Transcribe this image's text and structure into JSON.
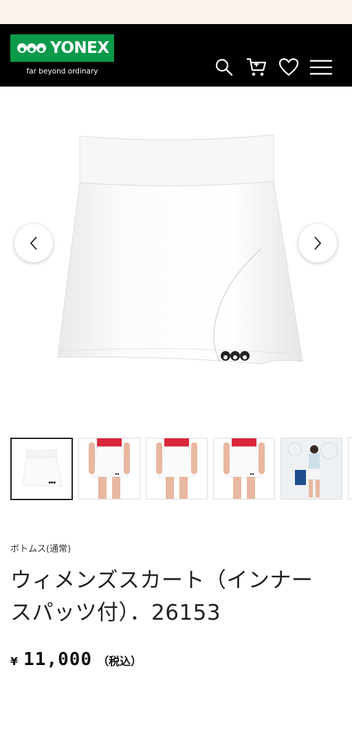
{
  "brand": {
    "name": "YONEX",
    "tagline": "far beyond ordinary",
    "color": "#0a9a4a"
  },
  "header": {
    "icons": [
      "search-icon",
      "cart-icon",
      "heart-icon",
      "menu-icon"
    ]
  },
  "gallery": {
    "prev_icon": "chevron-left-icon",
    "next_icon": "chevron-right-icon",
    "thumbnails": [
      "skirt-front",
      "model-front",
      "model-front-2",
      "model-front-3",
      "model-court",
      "partial"
    ]
  },
  "product": {
    "category": "ボトムス(通常)",
    "title": "ウィメンズスカート（インナースパッツ付）．26153",
    "price_symbol": "¥",
    "price": "11,000",
    "tax_note": "（税込）"
  }
}
